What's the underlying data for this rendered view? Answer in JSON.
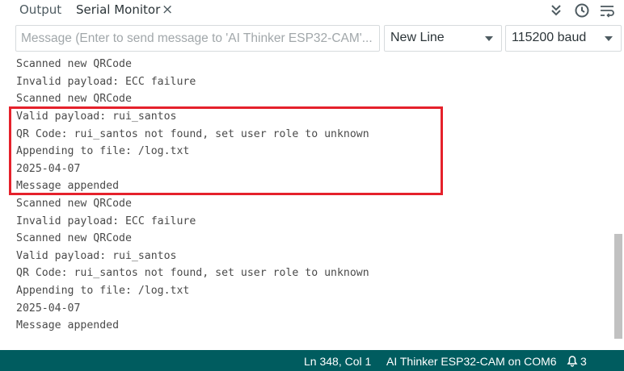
{
  "tabs": {
    "output_label": "Output",
    "serial_label": "Serial Monitor",
    "close_glyph": "×"
  },
  "toolbar": {
    "icons": [
      "double-chevron-down-icon",
      "clock-icon",
      "word-wrap-icon"
    ]
  },
  "controls": {
    "message_placeholder": "Message (Enter to send message to 'AI Thinker ESP32-CAM'...",
    "message_value": "",
    "line_ending": "New Line",
    "baud_rate": "115200 baud"
  },
  "output": {
    "lines": [
      "Scanned new QRCode",
      "Invalid payload: ECC failure",
      "Scanned new QRCode",
      "Valid payload: rui_santos",
      "QR Code: rui_santos not found, set user role to unknown",
      "Appending to file: /log.txt",
      "2025-04-07",
      "Message appended",
      "Scanned new QRCode",
      "Invalid payload: ECC failure",
      "Scanned new QRCode",
      "Valid payload: rui_santos",
      "QR Code: rui_santos not found, set user role to unknown",
      "Appending to file: /log.txt",
      "2025-04-07",
      "Message appended"
    ],
    "highlight_color": "#e5212b"
  },
  "statusbar": {
    "cursor_position": "Ln 348, Col 1",
    "board_port": "AI Thinker ESP32-CAM on COM6",
    "notification_count": "3",
    "background": "#005c5f"
  }
}
